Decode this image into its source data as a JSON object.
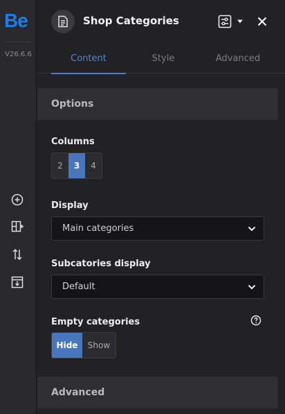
{
  "rail": {
    "logo": "Be",
    "version": "V26.6.6",
    "icons": [
      "add-circle-icon",
      "layout-add-icon",
      "sort-arrows-icon",
      "import-icon"
    ]
  },
  "header": {
    "title": "Shop Categories",
    "title_icon": "document-icon",
    "settings_icon": "sliders-icon",
    "dropdown_icon": "caret-down-icon",
    "close_icon": "close-icon"
  },
  "tabs": [
    {
      "label": "Content",
      "active": true
    },
    {
      "label": "Style",
      "active": false
    },
    {
      "label": "Advanced",
      "active": false
    }
  ],
  "options": {
    "section_title": "Options",
    "columns": {
      "label": "Columns",
      "options": [
        "2",
        "3",
        "4"
      ],
      "selected": "3"
    },
    "display": {
      "label": "Display",
      "value": "Main categories"
    },
    "subcategories": {
      "label": "Subcatories display",
      "value": "Default"
    },
    "empty": {
      "label": "Empty categories",
      "options": [
        "Hide",
        "Show"
      ],
      "selected": "Hide"
    }
  },
  "advanced_section": {
    "title": "Advanced"
  },
  "colors": {
    "accent": "#4877be",
    "brand": "#1e7de6",
    "tab_active": "#4e8ad6"
  }
}
